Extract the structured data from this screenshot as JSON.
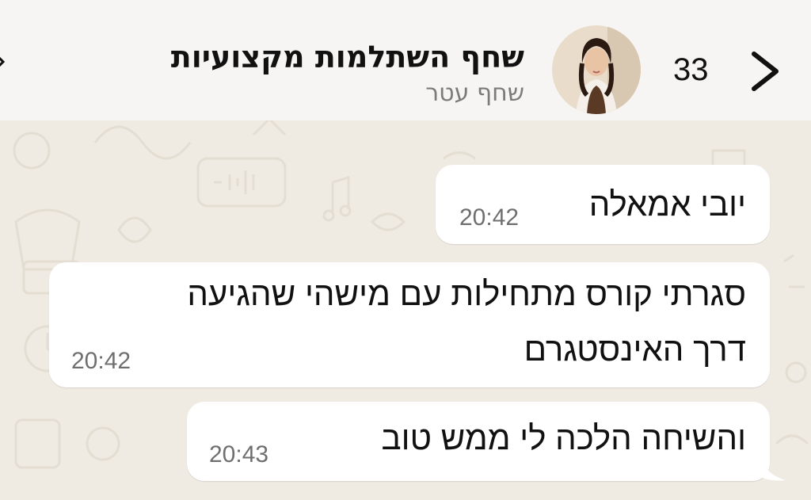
{
  "header": {
    "unread_count": "33",
    "back_icon": "chevron-right-icon",
    "chat_title": "שחף השתלמות מקצועיות",
    "chat_subtitle": "שחף עטר",
    "avatar_icon": "contact-avatar-photo"
  },
  "messages": [
    {
      "text": "יובי אמאלה",
      "time": "20:42",
      "direction": "incoming"
    },
    {
      "lines": [
        "סגרתי קורס מתחילות עם מישהי שהגיעה",
        "דרך האינסטגרם"
      ],
      "time": "20:42",
      "direction": "incoming"
    },
    {
      "text": "והשיחה הלכה לי ממש טוב",
      "time": "20:43",
      "direction": "incoming"
    }
  ],
  "colors": {
    "wallpaper": "#efeae2",
    "header_bg": "#f6f5f3",
    "bubble_bg": "#ffffff",
    "time_text": "#6f6f6f"
  }
}
